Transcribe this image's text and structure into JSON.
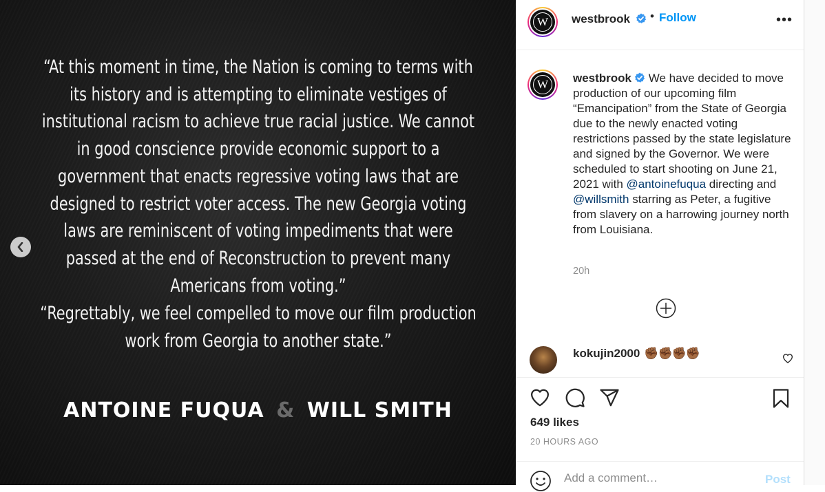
{
  "media": {
    "quote_paragraph_1": "“At this moment in time, the Nation is coming to terms with its history and is attempting to eliminate vestiges of institutional racism to achieve true racial justice. We cannot in good conscience provide economic support to a government that enacts regressive voting laws that are designed to restrict voter access. The new Georgia voting laws are reminiscent of voting impediments that were passed at the end of Reconstruction to prevent many Americans from voting.”",
    "quote_paragraph_2": "“Regrettably, we feel compelled to move our film production work from Georgia to another state.”",
    "credit_name_1": "ANTOINE FUQUA",
    "credit_amp": "&",
    "credit_name_2": "WILL SMITH"
  },
  "post_header": {
    "username": "westbrook",
    "separator": "•",
    "follow_label": "Follow",
    "more_label": "•••"
  },
  "caption": {
    "username": "westbrook",
    "text_part1": " We have decided to move production of our upcoming film “Emancipation” from the State of Georgia due to the newly enacted voting restrictions passed by the state legislature and signed by the Governor. We were scheduled to start shooting on June 21, 2021 with ",
    "mention1": "@antoinefuqua",
    "text_part2": " directing and ",
    "mention2": "@willsmith",
    "text_part3": " starring as Peter, a fugitive from slavery on a harrowing journey north from Louisiana.",
    "time": "20h"
  },
  "comment": {
    "username": "kokujin2000",
    "text": "✊🏾✊🏾✊🏾✊🏾"
  },
  "actions": {
    "likes": "649 likes",
    "time_ago": "20 HOURS AGO"
  },
  "add_comment": {
    "placeholder": "Add a comment…",
    "post_label": "Post"
  },
  "colors": {
    "accent": "#0095f6",
    "mention": "#00376b",
    "muted": "#8e8e8e",
    "verified": "#3897f0",
    "post_disabled": "#b2dffc"
  }
}
